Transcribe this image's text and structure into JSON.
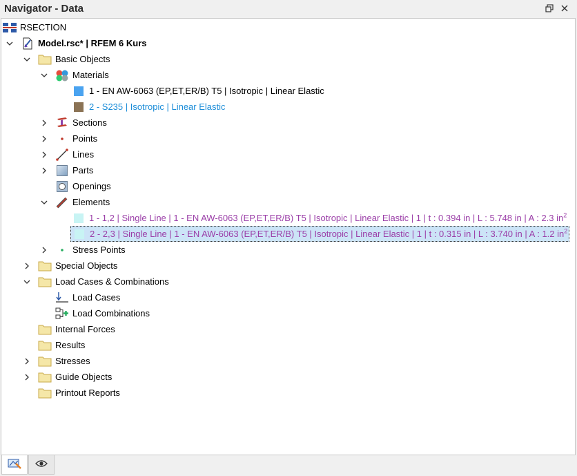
{
  "window": {
    "title": "Navigator - Data",
    "restore_icon": "restore-icon",
    "close_icon": "close-icon"
  },
  "tree": {
    "root": "RSECTION",
    "model": "Model.rsc* | RFEM 6 Kurs",
    "basic_objects": "Basic Objects",
    "materials": "Materials",
    "material_1": "1 - EN AW-6063 (EP,ET,ER/B) T5 | Isotropic | Linear Elastic",
    "material_2": "2 - S235 | Isotropic | Linear Elastic",
    "sections": "Sections",
    "points": "Points",
    "lines": "Lines",
    "parts": "Parts",
    "openings": "Openings",
    "elements": "Elements",
    "element_1": "1 - 1,2 | Single Line | 1 - EN AW-6063 (EP,ET,ER/B) T5 | Isotropic | Linear Elastic | 1 | t : 0.394 in | L : 5.748 in | A : 2.3 in",
    "element_1_sup": "2",
    "element_2": "2 - 2,3 | Single Line | 1 - EN AW-6063 (EP,ET,ER/B) T5 | Isotropic | Linear Elastic | 1 | t : 0.315 in | L : 3.740 in | A : 1.2 in",
    "element_2_sup": "2",
    "stress_points": "Stress Points",
    "special_objects": "Special Objects",
    "load_cases_combinations": "Load Cases & Combinations",
    "load_cases": "Load Cases",
    "load_combinations": "Load Combinations",
    "internal_forces": "Internal Forces",
    "results": "Results",
    "stresses": "Stresses",
    "guide_objects": "Guide Objects",
    "printout_reports": "Printout Reports"
  },
  "colors": {
    "material_1": "#4aa3f0",
    "material_2": "#8b7355",
    "element_swatch": "#c8f4f4",
    "selection": "#cce4f7",
    "folder": "#f5e7a8"
  }
}
